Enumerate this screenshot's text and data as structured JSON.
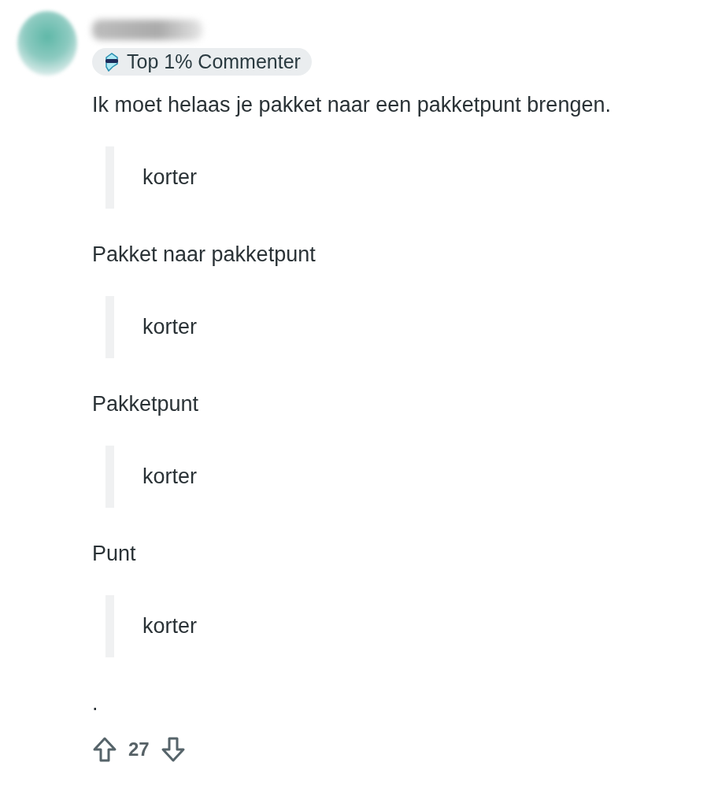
{
  "comment": {
    "badge": "Top 1% Commenter",
    "blocks": [
      {
        "kind": "paragraph",
        "text": "Ik moet helaas je pakket naar een pakketpunt brengen."
      },
      {
        "kind": "quote",
        "text": "korter"
      },
      {
        "kind": "paragraph",
        "text": "Pakket naar pakketpunt"
      },
      {
        "kind": "quote",
        "text": "korter"
      },
      {
        "kind": "paragraph",
        "text": "Pakketpunt"
      },
      {
        "kind": "quote",
        "text": "korter"
      },
      {
        "kind": "paragraph",
        "text": "Punt"
      },
      {
        "kind": "quote",
        "text": "korter"
      },
      {
        "kind": "paragraph",
        "text": "."
      }
    ],
    "score": "27"
  }
}
